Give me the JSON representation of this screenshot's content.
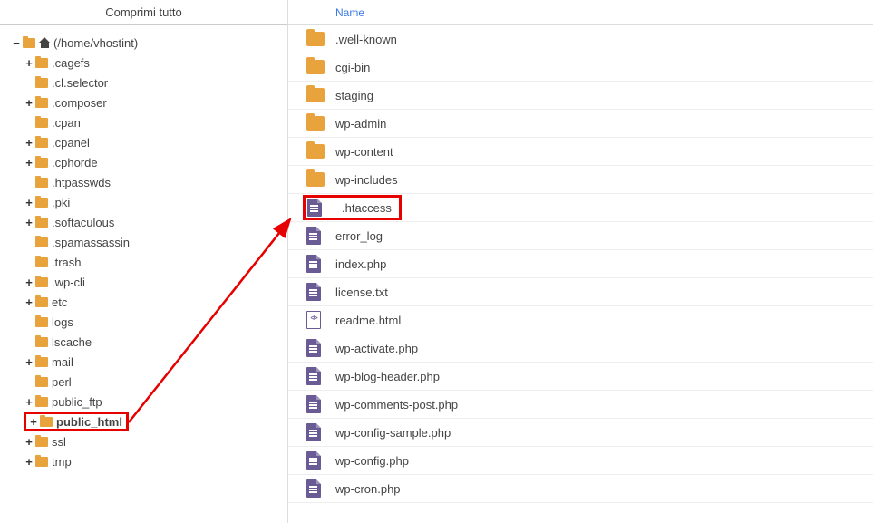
{
  "collapse_label": "Comprimi tutto",
  "root_label": "(/home/vhostint)",
  "tree": [
    {
      "toggle": "+",
      "label": ".cagefs"
    },
    {
      "toggle": "",
      "label": ".cl.selector"
    },
    {
      "toggle": "+",
      "label": ".composer"
    },
    {
      "toggle": "",
      "label": ".cpan"
    },
    {
      "toggle": "+",
      "label": ".cpanel"
    },
    {
      "toggle": "+",
      "label": ".cphorde"
    },
    {
      "toggle": "",
      "label": ".htpasswds"
    },
    {
      "toggle": "+",
      "label": ".pki"
    },
    {
      "toggle": "+",
      "label": ".softaculous"
    },
    {
      "toggle": "",
      "label": ".spamassassin"
    },
    {
      "toggle": "",
      "label": ".trash"
    },
    {
      "toggle": "+",
      "label": ".wp-cli"
    },
    {
      "toggle": "+",
      "label": "etc"
    },
    {
      "toggle": "",
      "label": "logs"
    },
    {
      "toggle": "",
      "label": "lscache"
    },
    {
      "toggle": "+",
      "label": "mail"
    },
    {
      "toggle": "",
      "label": "perl"
    },
    {
      "toggle": "+",
      "label": "public_ftp"
    },
    {
      "toggle": "+",
      "label": "public_html",
      "bold": true,
      "highlight": true
    },
    {
      "toggle": "+",
      "label": "ssl"
    },
    {
      "toggle": "+",
      "label": "tmp"
    }
  ],
  "table_header_name": "Name",
  "files": [
    {
      "type": "folder",
      "name": ".well-known"
    },
    {
      "type": "folder",
      "name": "cgi-bin"
    },
    {
      "type": "folder",
      "name": "staging"
    },
    {
      "type": "folder",
      "name": "wp-admin"
    },
    {
      "type": "folder",
      "name": "wp-content"
    },
    {
      "type": "folder",
      "name": "wp-includes"
    },
    {
      "type": "doc",
      "name": ".htaccess",
      "highlight": true
    },
    {
      "type": "doc",
      "name": "error_log"
    },
    {
      "type": "doc",
      "name": "index.php"
    },
    {
      "type": "doc",
      "name": "license.txt"
    },
    {
      "type": "code",
      "name": "readme.html"
    },
    {
      "type": "doc",
      "name": "wp-activate.php"
    },
    {
      "type": "doc",
      "name": "wp-blog-header.php"
    },
    {
      "type": "doc",
      "name": "wp-comments-post.php"
    },
    {
      "type": "doc",
      "name": "wp-config-sample.php"
    },
    {
      "type": "doc",
      "name": "wp-config.php"
    },
    {
      "type": "doc",
      "name": "wp-cron.php"
    }
  ]
}
